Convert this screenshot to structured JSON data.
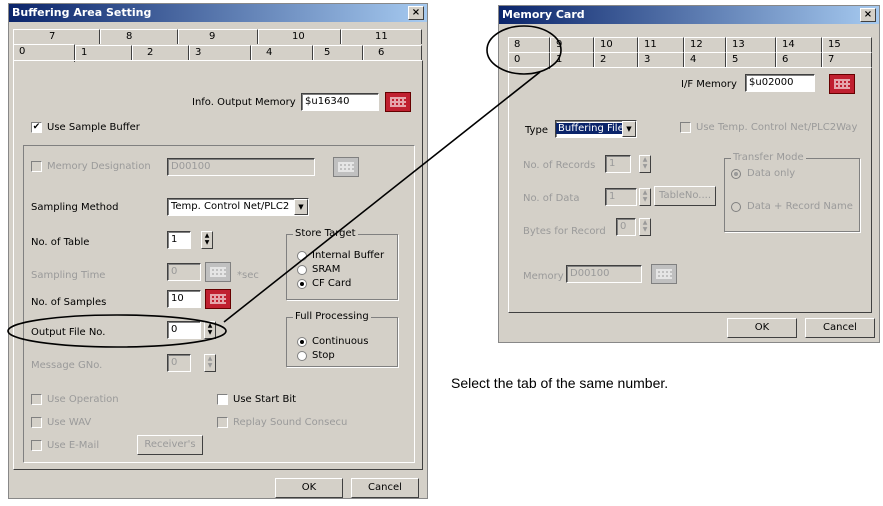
{
  "left_dialog": {
    "title": "Buffering Area Setting",
    "close": "×",
    "tabs_back": [
      "7",
      "8",
      "9",
      "10",
      "11"
    ],
    "tabs_front": [
      "0",
      "1",
      "2",
      "3",
      "4",
      "5",
      "6"
    ],
    "info_output_label": "Info. Output Memory",
    "info_output_value": "$u16340",
    "use_sample_buffer": "Use Sample Buffer",
    "use_sample_buffer_checked": "✔",
    "memory_designation": "Memory Designation",
    "memory_designation_value": "D00100",
    "sampling_method_label": "Sampling Method",
    "sampling_method_value": "Temp. Control Net/PLC2",
    "no_of_table_label": "No. of Table",
    "no_of_table_value": "1",
    "sampling_time_label": "Sampling Time",
    "sampling_time_value": "0",
    "sampling_time_unit": "*sec",
    "no_of_samples_label": "No. of Samples",
    "no_of_samples_value": "10",
    "output_file_label": "Output File No.",
    "output_file_value": "0",
    "message_gno_label": "Message GNo.",
    "message_gno_value": "0",
    "store_target": {
      "label": "Store Target",
      "options": [
        "Internal Buffer",
        "SRAM",
        "CF Card"
      ]
    },
    "full_processing": {
      "label": "Full Processing",
      "options": [
        "Continuous",
        "Stop"
      ]
    },
    "use_operation": "Use Operation",
    "use_start_bit": "Use Start Bit",
    "use_wav": "Use WAV",
    "replay_sound": "Replay Sound Consecu",
    "use_email": "Use E-Mail",
    "receivers": "Receiver's",
    "ok": "OK",
    "cancel": "Cancel"
  },
  "right_dialog": {
    "title": "Memory Card",
    "close": "×",
    "tabs_back": [
      "8",
      "9",
      "10",
      "11",
      "12",
      "13",
      "14",
      "15"
    ],
    "tabs_front": [
      "0",
      "1",
      "2",
      "3",
      "4",
      "5",
      "6",
      "7"
    ],
    "if_memory_label": "I/F Memory",
    "if_memory_value": "$u02000",
    "type_label": "Type",
    "type_value": "Buffering File",
    "use_temp_control": "Use Temp. Control Net/PLC2Way",
    "no_of_records_label": "No. of Records",
    "no_of_records_value": "1",
    "no_of_data_label": "No. of Data",
    "no_of_data_value": "1",
    "tableno": "TableNo....",
    "bytes_for_record_label": "Bytes for Record",
    "bytes_for_record_value": "0",
    "transfer_mode": {
      "label": "Transfer Mode",
      "options": [
        "Data only",
        "Data + Record Name"
      ]
    },
    "memory_label": "Memory",
    "memory_value": "D00100",
    "ok": "OK",
    "cancel": "Cancel"
  },
  "caption": "Select the tab of the same number."
}
